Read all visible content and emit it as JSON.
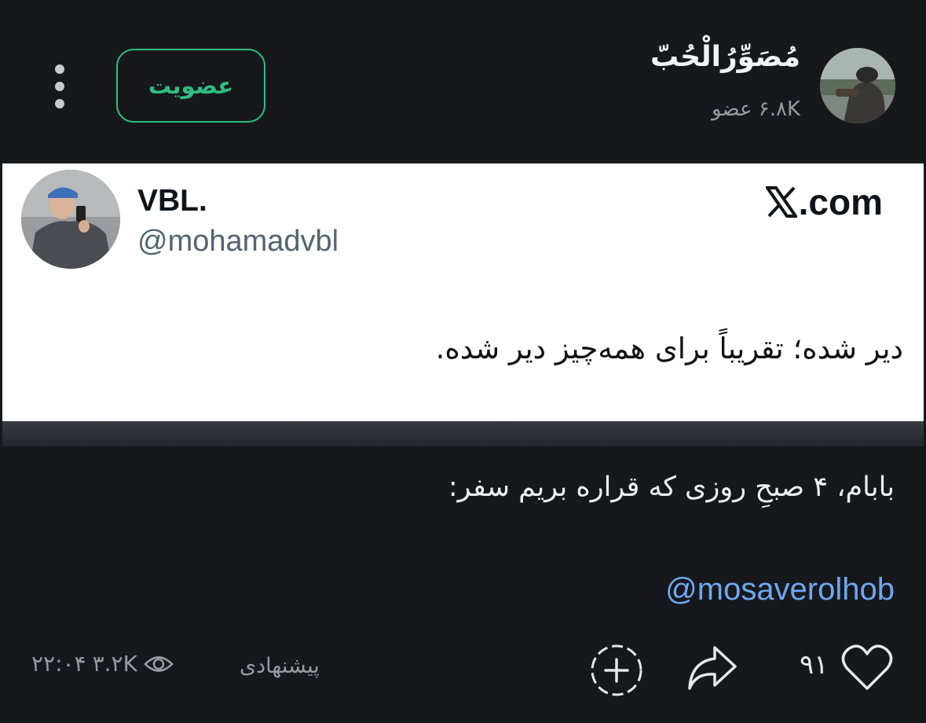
{
  "header": {
    "channel_name": "مُصَوِّرُالْحُبّ",
    "member_count": "۶.۸K عضو",
    "join_label": "عضویت",
    "more_icon": "more-vertical-icon",
    "colors": {
      "accent": "#2fbd83",
      "background": "#17181c"
    }
  },
  "tweet": {
    "source": ".com",
    "display_name": "VBL.",
    "handle": "@mohamadvbl",
    "text": "دیر شده؛ تقریباً برای همه‌چیز دیر شده."
  },
  "post": {
    "text": "بابام، ۴ صبحِ روزی که قراره بریم سفر:",
    "link": "@mosaverolhob"
  },
  "footer": {
    "time": "۲۲:۰۴",
    "views": "۳.۲K",
    "suggested": "پیشنهادی",
    "like_count": "۹۱",
    "icons": [
      "eye-icon",
      "add-reaction-icon",
      "share-icon",
      "heart-icon"
    ]
  }
}
